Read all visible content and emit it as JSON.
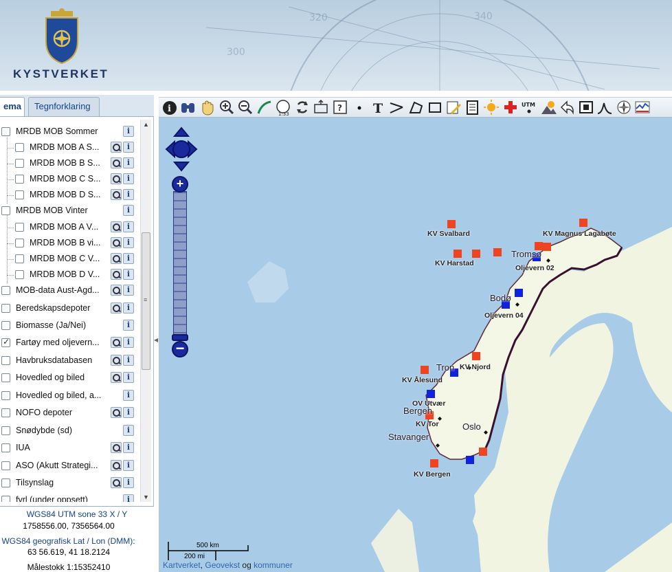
{
  "header": {
    "brand": "KYSTVERKET"
  },
  "tabs": {
    "tema": "ema",
    "legend": "Tegnforklaring"
  },
  "layers": [
    {
      "label": "MRDB MOB Sommer",
      "indent": 0,
      "checked": false,
      "zoom": false
    },
    {
      "label": "MRDB MOB A S...",
      "indent": 1,
      "checked": false,
      "zoom": true
    },
    {
      "label": "MRDB MOB B S...",
      "indent": 1,
      "checked": false,
      "zoom": true
    },
    {
      "label": "MRDB MOB C S...",
      "indent": 1,
      "checked": false,
      "zoom": true
    },
    {
      "label": "MRDB MOB D S...",
      "indent": 1,
      "checked": false,
      "zoom": true
    },
    {
      "label": "MRDB MOB Vinter",
      "indent": 0,
      "checked": false,
      "zoom": false
    },
    {
      "label": "MRDB MOB A V...",
      "indent": 1,
      "checked": false,
      "zoom": true
    },
    {
      "label": "MRDB MOB B vi...",
      "indent": 1,
      "checked": false,
      "zoom": true
    },
    {
      "label": "MRDB MOB C V...",
      "indent": 1,
      "checked": false,
      "zoom": true
    },
    {
      "label": "MRDB MOB D V...",
      "indent": 1,
      "checked": false,
      "zoom": true
    },
    {
      "label": "MOB-data Aust-Agd...",
      "indent": 0,
      "checked": false,
      "zoom": true
    },
    {
      "label": "Beredskapsdepoter",
      "indent": 0,
      "checked": false,
      "zoom": true
    },
    {
      "label": "Biomasse (Ja/Nei)",
      "indent": 0,
      "checked": false,
      "zoom": false
    },
    {
      "label": "Fartøy med oljevern...",
      "indent": 0,
      "checked": true,
      "zoom": true
    },
    {
      "label": "Havbruksdatabasen",
      "indent": 0,
      "checked": false,
      "zoom": true
    },
    {
      "label": "Hovedled og biled",
      "indent": 0,
      "checked": false,
      "zoom": true
    },
    {
      "label": "Hovedled og biled, a...",
      "indent": 0,
      "checked": false,
      "zoom": false
    },
    {
      "label": "NOFO depoter",
      "indent": 0,
      "checked": false,
      "zoom": true
    },
    {
      "label": "Snødybde (sd)",
      "indent": 0,
      "checked": false,
      "zoom": false
    },
    {
      "label": "IUA",
      "indent": 0,
      "checked": false,
      "zoom": true
    },
    {
      "label": "ASO (Akutt Strategi...",
      "indent": 0,
      "checked": false,
      "zoom": true
    },
    {
      "label": "Tilsynslag",
      "indent": 0,
      "checked": false,
      "zoom": true
    },
    {
      "label": "fyrl (under oppsett)",
      "indent": 0,
      "checked": false,
      "zoom": false
    }
  ],
  "coords": {
    "utm_label": "WGS84 UTM sone 33 X / Y",
    "utm_value": "1758556.00, 7356564.00",
    "geo_label": "WGS84 geografisk Lat / Lon (DMM):",
    "geo_value": "63 56.619, 41 18.2124",
    "scale": "Målestokk 1:15352410"
  },
  "toolbar": {
    "scale_tool_label": "1:33",
    "utm_tool_label": "UTM"
  },
  "map": {
    "vessel_labels": [
      {
        "text": "KV Svalbard"
      },
      {
        "text": "KV Magnus Lagabøte"
      },
      {
        "text": "KV Harstad"
      },
      {
        "text": "Oljevern 02"
      },
      {
        "text": "Oljevern 04"
      },
      {
        "text": "KV Njord"
      },
      {
        "text": "KV Ålesund"
      },
      {
        "text": "OV Utvær"
      },
      {
        "text": "KV Tor"
      },
      {
        "text": "KV Bergen"
      }
    ],
    "cities": [
      {
        "text": "Tromsø"
      },
      {
        "text": "Bodø"
      },
      {
        "text": "Tron"
      },
      {
        "text": "Bergen"
      },
      {
        "text": "Oslo"
      },
      {
        "text": "Stavanger"
      }
    ],
    "colors": {
      "coastguard": "#ee4422",
      "oil_recovery": "#1122dd",
      "sea": "#a8cbe8",
      "land": "#f2f4e2"
    }
  },
  "scale_bar": {
    "km": "500 km",
    "mi": "200 mi"
  },
  "credits": {
    "kartverket": "Kartverket",
    "sep": ",",
    "geovekst": "Geovekst",
    "og": "og",
    "kommuner": "kommuner"
  }
}
